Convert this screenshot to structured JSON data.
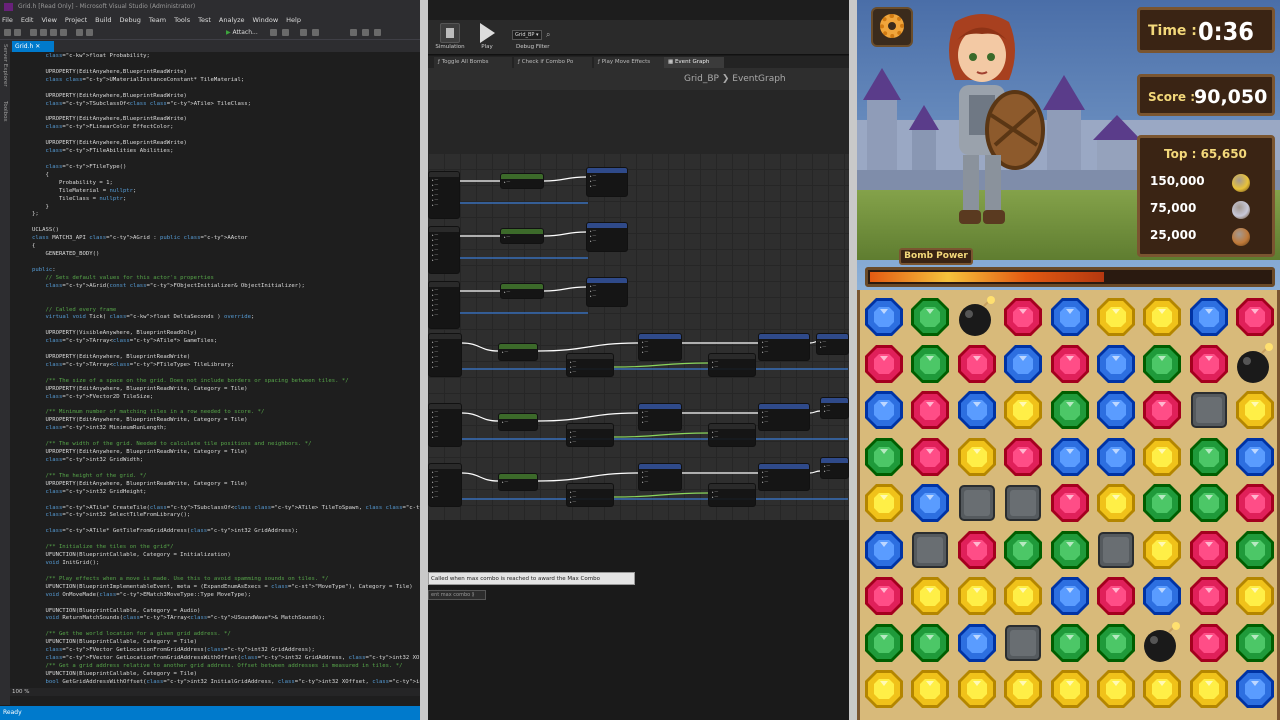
{
  "vs": {
    "title": "Grid.h [Read Only] - Microsoft Visual Studio (Administrator)",
    "menu": [
      "File",
      "Edit",
      "View",
      "Project",
      "Build",
      "Debug",
      "Team",
      "Tools",
      "Test",
      "Analyze",
      "Window",
      "Help"
    ],
    "attach_label": "Attach...",
    "tab_label": "Grid.h",
    "side_tabs": [
      "Server Explorer",
      "Toolbox"
    ],
    "zoom": "100 %",
    "status": "Ready",
    "code_lines": [
      "    float Probability;",
      "",
      "    UPROPERTY(EditAnywhere,BlueprintReadWrite)",
      "    class UMaterialInstanceConstant* TileMaterial;",
      "",
      "    UPROPERTY(EditAnywhere,BlueprintReadWrite)",
      "    TSubclassOf<class ATile> TileClass;",
      "",
      "    UPROPERTY(EditAnywhere,BlueprintReadWrite)",
      "    FLinearColor EffectColor;",
      "",
      "    UPROPERTY(EditAnywhere,BlueprintReadWrite)",
      "    FTileAbilities Abilities;",
      "",
      "    FTileType()",
      "    {",
      "        Probability = 1;",
      "        TileMaterial = nullptr;",
      "        TileClass = nullptr;",
      "    }",
      "};",
      "",
      "UCLASS()",
      "class MATCH3_API AGrid : public AActor",
      "{",
      "    GENERATED_BODY()",
      "",
      "public:",
      "    // Sets default values for this actor's properties",
      "    AGrid(const FObjectInitializer& ObjectInitializer);",
      "",
      "",
      "    // Called every frame",
      "    virtual void Tick( float DeltaSeconds ) override;",
      "",
      "    UPROPERTY(VisibleAnywhere, BlueprintReadOnly)",
      "    TArray<ATile*> GameTiles;",
      "",
      "    UPROPERTY(EditAnywhere, BlueprintReadWrite)",
      "    TArray<FTileType> TileLibrary;",
      "",
      "    /** The size of a space on the grid. Does not include borders or spacing between tiles. */",
      "    UPROPERTY(EditAnywhere, BlueprintReadWrite, Category = Tile)",
      "    FVector2D TileSize;",
      "",
      "    /** Minimum number of matching tiles in a row needed to score. */",
      "    UPROPERTY(EditAnywhere, BlueprintReadWrite, Category = Tile)",
      "    int32 MinimumRunLength;",
      "",
      "    /** The width of the grid. Needed to calculate tile positions and neighbors. */",
      "    UPROPERTY(EditAnywhere, BlueprintReadWrite, Category = Tile)",
      "    int32 GridWidth;",
      "",
      "    /** The height of the grid. */",
      "    UPROPERTY(EditAnywhere, BlueprintReadWrite, Category = Tile)",
      "    int32 GridHeight;",
      "",
      "    ATile* CreateTile(TSubclassOf<class ATile> TileToSpawn, class UMaterialInstanceConstant* TileMaterial, F",
      "    int32 SelectTileFromLibrary();",
      "",
      "    ATile* GetTileFromGridAddress(int32 GridAddress);",
      "",
      "    /** Initialize the tiles on the grid*/",
      "    UFUNCTION(BlueprintCallable, Category = Initialization)",
      "    void InitGrid();",
      "",
      "    /** Play effects when a move is made. Use this to avoid spamming sounds on tiles. */",
      "    UFUNCTION(BlueprintImplementableEvent, meta = (ExpandEnumAsExecs = \"MoveType\"), Category = Tile)",
      "    void OnMoveMade(EMatch3MoveType::Type MoveType);",
      "",
      "    UFUNCTION(BlueprintCallable, Category = Audio)",
      "    void ReturnMatchSounds(TArray<USoundWave*>& MatchSounds);",
      "",
      "    /** Get the world location for a given grid address. */",
      "    UFUNCTION(BlueprintCallable, Category = Tile)",
      "    FVector GetLocationFromGridAddress(int32 GridAddress);",
      "    FVector GetLocationFromGridAddressWithOffset(int32 GridAddress, int32 XOffsetInTiles, int32 YOffsetInTi",
      "    /** Get a grid address relative to another grid address. Offset between addresses is measured in tiles. */",
      "    UFUNCTION(BlueprintCallable, Category = Tile)",
      "    bool GetGridAddressWithOffset(int32 InitialGridAddress, int32 XOffset, int32 YOffset, int32 &ReturnGridA"
    ]
  },
  "ue": {
    "toolbar": {
      "simulation_label": "Simulation",
      "play_label": "Play",
      "combo_value": "Grid_BP",
      "filter_label": "Debug Filter"
    },
    "tabs": [
      "Toggle All Bombs",
      "Check if Combo Po",
      "Play Move Effects",
      "Event Graph"
    ],
    "breadcrumb": "Grid_BP  ❯  EventGraph",
    "tooltip": "Called when max combo is reached to award the Max Combo achievement",
    "tooltip2": "ent max combo ⟫"
  },
  "game": {
    "time_label": "Time :",
    "time_value": "0:36",
    "score_label": "Score :",
    "score_value": "90,050",
    "top_label": "Top : 65,650",
    "ranks": [
      {
        "value": "150,000",
        "medal": "#e8c23a"
      },
      {
        "value": "75,000",
        "medal": "#c8c8d8"
      },
      {
        "value": "25,000",
        "medal": "#c07a3a"
      }
    ],
    "power_label": "Bomb Power",
    "power_level": 0.58,
    "colors": {
      "blue": "#2d6fe0",
      "green": "#1f9a3a",
      "red": "#e0205a",
      "yellow": "#f0c21a",
      "gray": "#555a5e",
      "bomb": "#1a1a1a"
    },
    "grid": [
      [
        "blue",
        "green",
        "bomb",
        "red",
        "blue",
        "yellow",
        "yellow",
        "blue",
        "red"
      ],
      [
        "red",
        "green",
        "red",
        "blue",
        "red",
        "blue",
        "green",
        "red",
        "bomb"
      ],
      [
        "blue",
        "red",
        "blue",
        "yellow",
        "green",
        "blue",
        "red",
        "gray",
        "yellow"
      ],
      [
        "green",
        "red",
        "yellow",
        "red",
        "blue",
        "blue",
        "yellow",
        "green",
        "blue"
      ],
      [
        "yellow",
        "blue",
        "gray",
        "gray",
        "red",
        "yellow",
        "green",
        "green",
        "red"
      ],
      [
        "blue",
        "gray",
        "red",
        "green",
        "green",
        "gray",
        "yellow",
        "red",
        "green"
      ],
      [
        "red",
        "yellow",
        "yellow",
        "yellow",
        "blue",
        "red",
        "blue",
        "red",
        "yellow"
      ],
      [
        "green",
        "green",
        "blue",
        "gray",
        "green",
        "green",
        "bomb",
        "red",
        "green"
      ],
      [
        "yellow",
        "yellow",
        "yellow",
        "yellow",
        "yellow",
        "yellow",
        "yellow",
        "yellow",
        "blue"
      ]
    ]
  }
}
